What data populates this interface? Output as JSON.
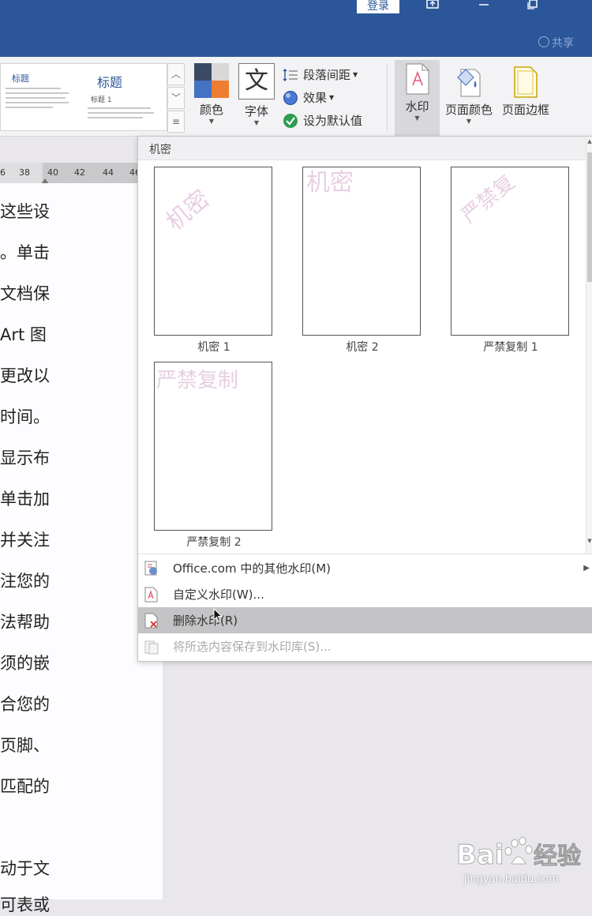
{
  "titlebar": {
    "login_label": "登录",
    "share_label": "共享",
    "icons": [
      "restore-ribbon-icon",
      "minimize-icon",
      "maximize-icon"
    ]
  },
  "ribbon": {
    "style_gallery": {
      "thumb1_title": "标题",
      "thumb2_title": "标题",
      "thumb2_subtitle": "标题 1"
    },
    "colors_label": "颜色",
    "fonts_label": "字体",
    "fonts_glyph": "文",
    "paragraph_spacing_label": "段落间距",
    "effects_label": "效果",
    "set_default_label": "设为默认值",
    "watermark_label": "水印",
    "page_color_label": "页面颜色",
    "page_borders_label": "页面边框"
  },
  "ruler": {
    "ticks": [
      "6",
      "38",
      "40",
      "42",
      "44",
      "46"
    ]
  },
  "document": {
    "lines": [
      "这些设",
      "。单击",
      "文档保",
      "Art 图",
      "更改以",
      "时间。",
      "显示布",
      "单击加",
      "并关注",
      "注您的",
      "法帮助",
      "须的嵌",
      "合您的",
      "页脚、",
      "匹配的",
      "",
      "动于文",
      "可表或"
    ]
  },
  "watermark_menu": {
    "section_header": "机密",
    "thumbnails": [
      {
        "label": "机密 1",
        "watermark": "机密"
      },
      {
        "label": "机密 2",
        "watermark": "机密"
      },
      {
        "label": "严禁复制 1",
        "watermark": "严禁复"
      },
      {
        "label": "严禁复制 2",
        "watermark": "严禁复制"
      }
    ],
    "items": [
      {
        "label": "Office.com 中的其他水印(M)",
        "state": "normal"
      },
      {
        "label": "自定义水印(W)...",
        "state": "normal"
      },
      {
        "label": "删除水印(R)",
        "state": "hover"
      },
      {
        "label": "将所选内容保存到水印库(S)...",
        "state": "disabled"
      }
    ]
  },
  "colors": {
    "titlebar": "#2b579a",
    "accent_text": "#2b579a",
    "watermark_pink": "#e7cfe2"
  }
}
